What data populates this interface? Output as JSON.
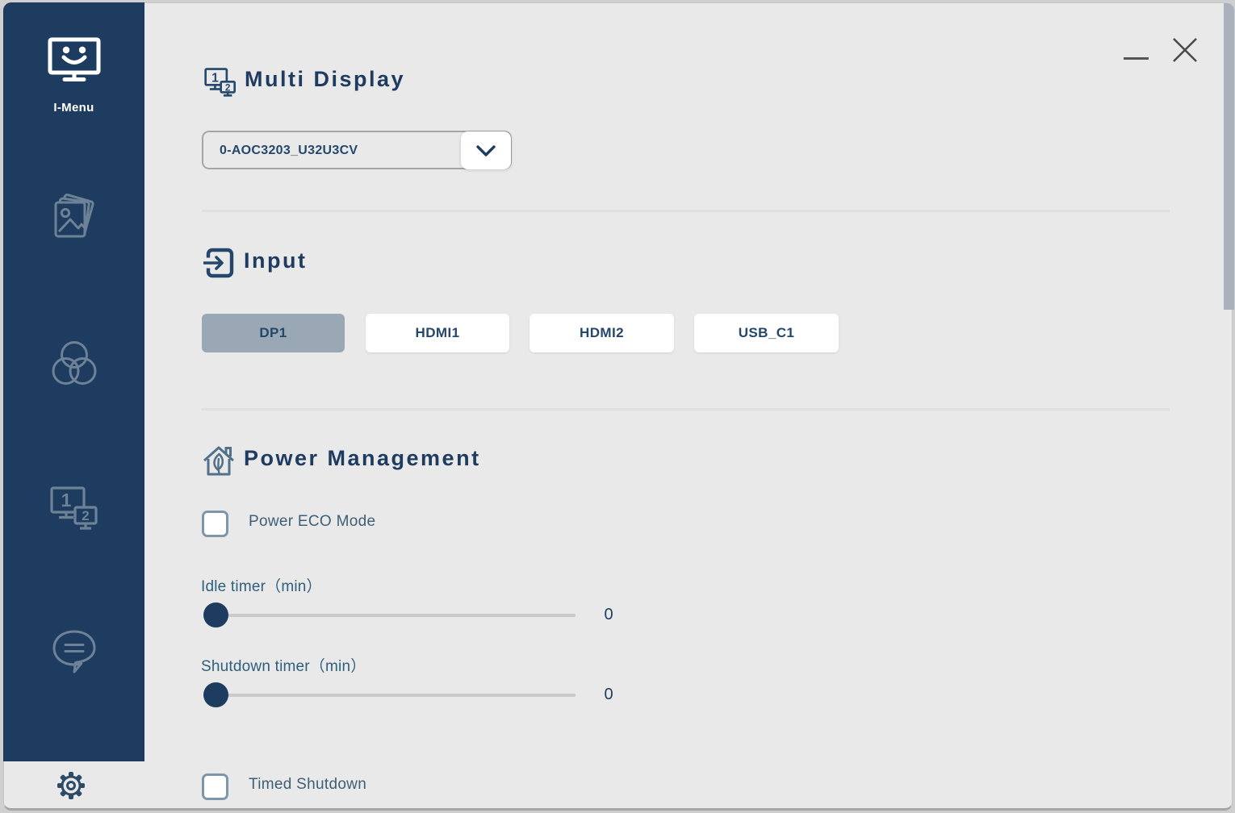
{
  "colors": {
    "sidebar_bg": "#1e3c5f",
    "accent_navy": "#1f3c60",
    "muted_icon": "#6d8296",
    "content_bg": "#e9e9e9",
    "selected_input_bg": "#9aa7b4",
    "checkbox_border": "#7e96a9",
    "slider_track": "#c9c9c9",
    "scrollbar_thumb": "#a9b2bc"
  },
  "sidebar": {
    "active_item": "I-Menu",
    "items": [
      {
        "name": "i-menu",
        "label": "I-Menu"
      },
      {
        "name": "image-settings"
      },
      {
        "name": "color-settings"
      },
      {
        "name": "multi-display"
      },
      {
        "name": "feedback"
      }
    ]
  },
  "icon_glyphs": {
    "monitor_one": "1",
    "monitor_two": "2"
  },
  "multi_display": {
    "title": "Multi Display",
    "selected_monitor": "0-AOC3203_U32U3CV"
  },
  "input": {
    "title": "Input",
    "selected": "DP1",
    "buttons": [
      {
        "label": "DP1"
      },
      {
        "label": "HDMI1"
      },
      {
        "label": "HDMI2"
      },
      {
        "label": "USB_C1"
      }
    ]
  },
  "power": {
    "title": "Power Management",
    "eco_mode": {
      "label": "Power ECO Mode",
      "checked": false
    },
    "idle_timer": {
      "label": "Idle timer（min）",
      "value": "0"
    },
    "shutdown_timer": {
      "label": "Shutdown timer（min）",
      "value": "0"
    },
    "timed_shutdown": {
      "label": "Timed Shutdown",
      "checked": false
    }
  }
}
